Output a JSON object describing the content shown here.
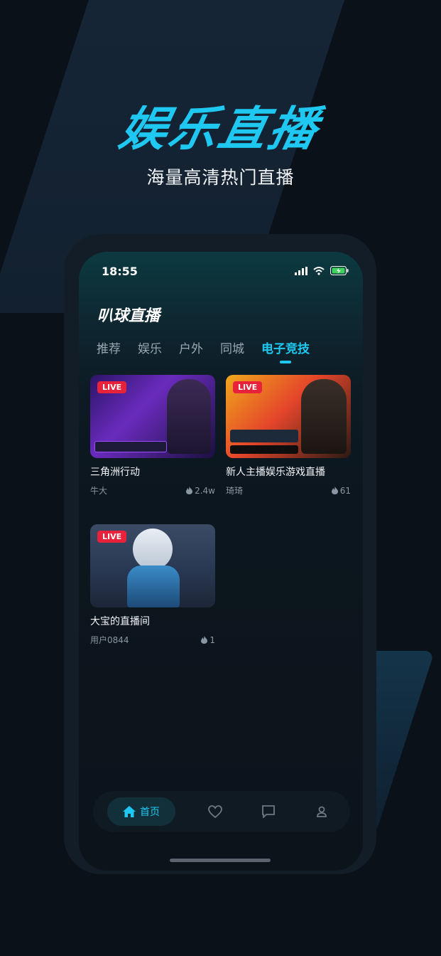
{
  "hero": {
    "title": "娱乐直播",
    "subtitle": "海量高清热门直播"
  },
  "status_bar": {
    "time": "18:55"
  },
  "app": {
    "title": "叭球直播"
  },
  "tabs": [
    {
      "label": "推荐",
      "active": false
    },
    {
      "label": "娱乐",
      "active": false
    },
    {
      "label": "户外",
      "active": false
    },
    {
      "label": "同城",
      "active": false
    },
    {
      "label": "电子竞技",
      "active": true
    }
  ],
  "streams": [
    {
      "badge": "LIVE",
      "title": "三角洲行动",
      "host": "牛大",
      "heat": "2.4w"
    },
    {
      "badge": "LIVE",
      "title": "新人主播娱乐游戏直播",
      "host": "琦琦",
      "heat": "61"
    },
    {
      "badge": "LIVE",
      "title": "大宝的直播间",
      "host": "用户0844",
      "heat": "1"
    }
  ],
  "nav": {
    "home_label": "首页"
  },
  "colors": {
    "accent": "#1ec8f0",
    "live": "#e8223a",
    "background": "#0b1119"
  }
}
